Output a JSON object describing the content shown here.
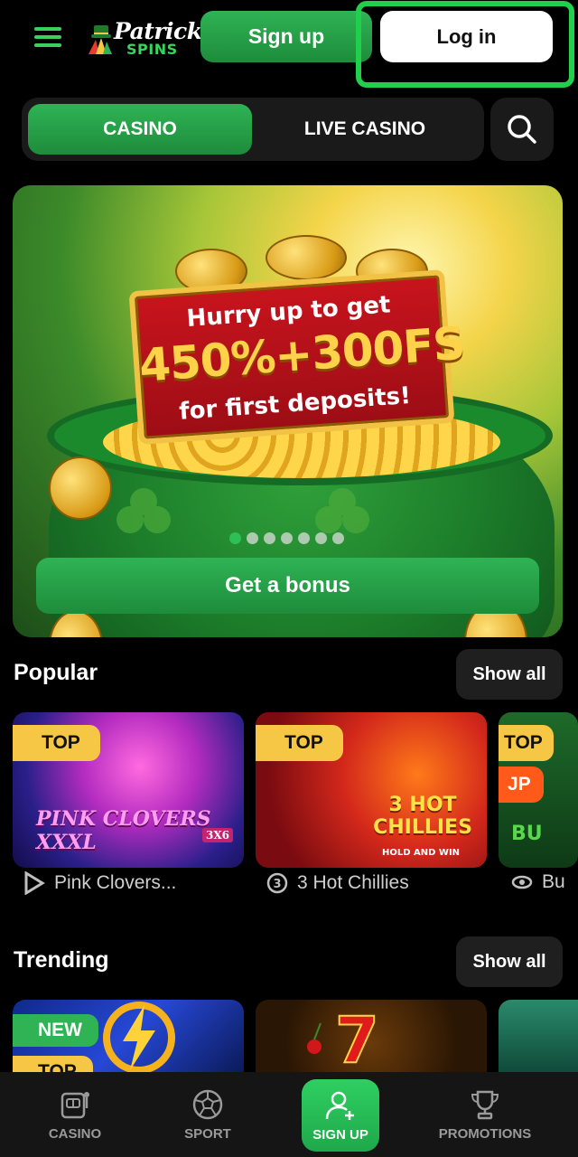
{
  "header": {
    "logo_name": "Patrick",
    "logo_sub": "SPINS",
    "signup_label": "Sign up",
    "login_label": "Log in"
  },
  "tabs": [
    {
      "label": "CASINO",
      "active": true
    },
    {
      "label": "LIVE CASINO",
      "active": false
    }
  ],
  "banner": {
    "line1": "Hurry up to get",
    "line2": "450%+300FS",
    "line3": "for first deposits!",
    "cta_label": "Get a bonus",
    "slide_count": 7,
    "active_slide": 0
  },
  "sections": {
    "popular": {
      "title": "Popular",
      "show_all_label": "Show all",
      "games": [
        {
          "badge": "TOP",
          "art_title": "PINK CLOVERS XXXL",
          "art_sub": "3X6",
          "label": "Pink Clovers...",
          "provider_icon": "play-triangle-icon"
        },
        {
          "badge": "TOP",
          "art_title": "3 HOT CHILLIES",
          "art_sub": "HOLD AND WIN",
          "label": "3 Hot Chillies",
          "provider_icon": "provider-3-icon"
        },
        {
          "badge": "TOP",
          "badge2": "JP",
          "art_title": "BU",
          "label": "Bu",
          "provider_icon": "eye-icon"
        }
      ]
    },
    "trending": {
      "title": "Trending",
      "show_all_label": "Show all",
      "games": [
        {
          "badge": "NEW",
          "badge2": "TOP"
        },
        {
          "badge": ""
        },
        {
          "badge": ""
        }
      ]
    }
  },
  "bottom_nav": [
    {
      "label": "CASINO",
      "icon": "slot-machine-icon"
    },
    {
      "label": "SPORT",
      "icon": "soccer-ball-icon"
    },
    {
      "label": "SIGN UP",
      "icon": "add-user-icon",
      "highlighted": true
    },
    {
      "label": "PROMOTIONS",
      "icon": "trophy-icon"
    }
  ],
  "colors": {
    "accent": "#2fb355",
    "badge_top": "#f6c744",
    "badge_jp": "#ff5a1a",
    "highlight_border": "#21d04a",
    "background": "#000000"
  }
}
